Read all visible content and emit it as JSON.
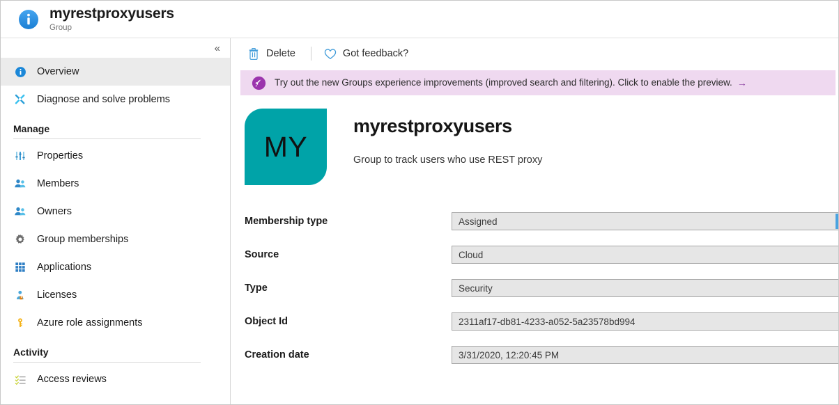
{
  "titlebar": {
    "icon": "info-circle-icon",
    "title": "myrestproxyusers",
    "subtitle": "Group"
  },
  "sidebar": {
    "collapse_glyph": "«",
    "top_items": [
      {
        "label": "Overview",
        "icon": "info-circle-icon",
        "selected": true
      },
      {
        "label": "Diagnose and solve problems",
        "icon": "wrench-screwdriver-icon",
        "selected": false
      }
    ],
    "sections": [
      {
        "title": "Manage",
        "items": [
          {
            "label": "Properties",
            "icon": "sliders-icon"
          },
          {
            "label": "Members",
            "icon": "people-icon"
          },
          {
            "label": "Owners",
            "icon": "people-icon"
          },
          {
            "label": "Group memberships",
            "icon": "gear-icon"
          },
          {
            "label": "Applications",
            "icon": "grid-apps-icon"
          },
          {
            "label": "Licenses",
            "icon": "person-badge-icon"
          },
          {
            "label": "Azure role assignments",
            "icon": "key-icon"
          }
        ]
      },
      {
        "title": "Activity",
        "items": [
          {
            "label": "Access reviews",
            "icon": "checklist-icon"
          }
        ]
      }
    ]
  },
  "toolbar": {
    "delete_label": "Delete",
    "delete_icon": "trash-icon",
    "feedback_label": "Got feedback?",
    "feedback_icon": "heart-icon"
  },
  "banner": {
    "icon": "rocket-icon",
    "text": "Try out the new Groups experience improvements (improved search and filtering). Click to enable the preview.",
    "arrow": "→",
    "background": "#efd9f0",
    "arrow_color": "#8a3fa0"
  },
  "group": {
    "initials": "MY",
    "tile_color": "#00a3a8",
    "name": "myrestproxyusers",
    "description": "Group to track users who use REST proxy"
  },
  "properties": [
    {
      "label": "Membership type",
      "value": "Assigned",
      "accent": true
    },
    {
      "label": "Source",
      "value": "Cloud",
      "accent": false
    },
    {
      "label": "Type",
      "value": "Security",
      "accent": false
    },
    {
      "label": "Object Id",
      "value": "2311af17-db81-4233-a052-5a23578bd994",
      "accent": false
    },
    {
      "label": "Creation date",
      "value": "3/31/2020, 12:20:45 PM",
      "accent": false
    }
  ]
}
